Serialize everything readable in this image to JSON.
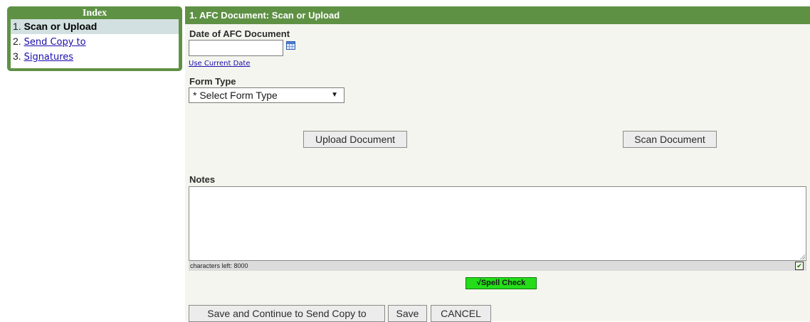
{
  "index": {
    "title": "Index",
    "items": [
      {
        "num": "1.",
        "label": "Scan or Upload"
      },
      {
        "num": "2.",
        "label": "Send Copy to"
      },
      {
        "num": "3.",
        "label": "Signatures"
      }
    ]
  },
  "main": {
    "header": "1. AFC Document: Scan or Upload",
    "date_label": "Date of AFC Document",
    "date_value": "",
    "use_current_date": "Use Current Date",
    "form_type_label": "Form Type",
    "form_type_selected": "* Select Form Type",
    "upload_button": "Upload Document",
    "scan_button": "Scan Document",
    "notes_label": "Notes",
    "notes_value": "",
    "characters_left": "characters left: 8000",
    "spell_check": "√Spell Check",
    "save_continue_button": "Save and Continue to Send Copy to",
    "save_button": "Save",
    "cancel_button": "CANCEL"
  },
  "colors": {
    "header_green": "#5f9145",
    "spell_green": "#24dd19",
    "panel_bg": "#f5f5ef",
    "link_blue": "#1a0dab"
  }
}
